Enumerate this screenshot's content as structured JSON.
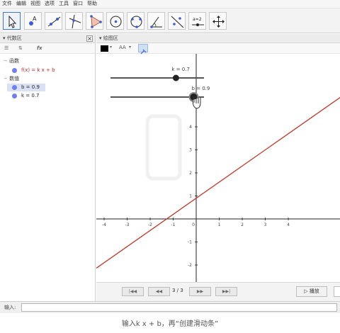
{
  "menu": [
    "文件",
    "编辑",
    "视图",
    "选项",
    "工具",
    "窗口",
    "帮助"
  ],
  "algebra": {
    "title": "代数区",
    "close": "×",
    "toolbar": {
      "sort": "⇅",
      "fx": "fx"
    },
    "groups": [
      {
        "label": "函数",
        "items": [
          {
            "text": "f(x) = k x + b",
            "color": "#c0202a"
          }
        ]
      },
      {
        "label": "数值",
        "items": [
          {
            "text": "b = 0.9",
            "color": "#222222",
            "selected": true
          },
          {
            "text": "k = 0.7",
            "color": "#222222"
          }
        ]
      }
    ]
  },
  "graphics": {
    "title": "绘图区",
    "text_size": "AA",
    "line_color": "#c0392b",
    "slider_k": {
      "label": "k = 0.7",
      "value": 0.7
    },
    "slider_b": {
      "label": "b = 0.9",
      "value": 0.9
    },
    "x_ticks": [
      "-4",
      "-3",
      "-2",
      "-1",
      "0",
      "1",
      "2",
      "3",
      "4"
    ],
    "y_ticks": [
      "4",
      "3",
      "2",
      "1",
      "-1",
      "-2",
      "-3"
    ],
    "navigation": {
      "step": "3 / 3",
      "play": "播放"
    }
  },
  "input": {
    "label": "输入:",
    "value": ""
  },
  "caption": "输入k x + b，再“创建滑动条”",
  "chart_data": {
    "type": "line",
    "series": [
      {
        "name": "f(x) = k x + b",
        "slope": 0.7,
        "intercept": 0.9
      }
    ],
    "xlim": [
      -4.5,
      4
    ],
    "ylim": [
      -3.5,
      5.5
    ],
    "grid": false
  }
}
